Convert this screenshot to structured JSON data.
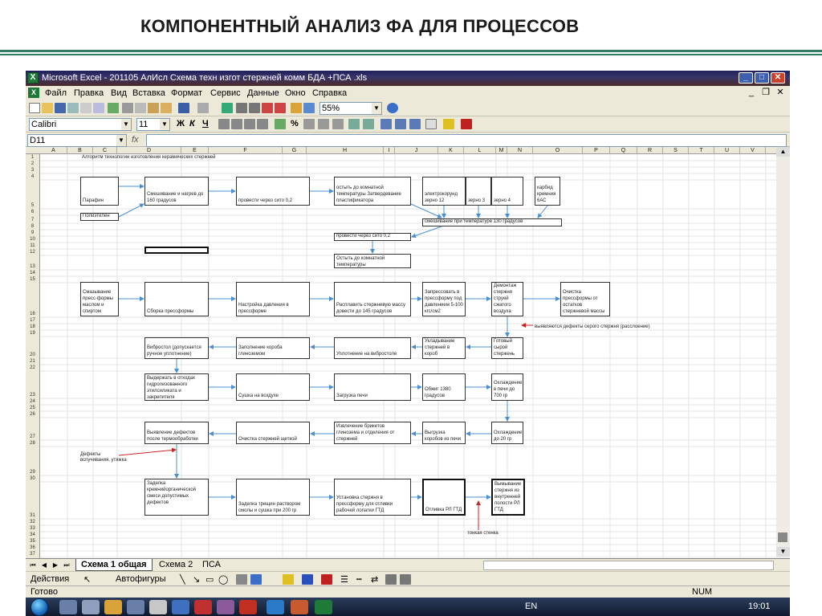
{
  "slide": {
    "title": "КОМПОНЕНТНЫЙ АНАЛИЗ ФА ДЛЯ ПРОЦЕССОВ"
  },
  "window": {
    "app_icon": "excel-icon",
    "caption": "Microsoft Excel - 201105 АлИсл Схема техн изгот стержней комм БДА +ПСА .xls"
  },
  "menu": [
    "Файл",
    "Правка",
    "Вид",
    "Вставка",
    "Формат",
    "Сервис",
    "Данные",
    "Окно",
    "Справка"
  ],
  "toolbar": {
    "zoom": "55%",
    "font": "Calibri",
    "size": "11"
  },
  "formula_bar": {
    "name_box": "D11",
    "fx": "fx"
  },
  "columns": [
    "A",
    "B",
    "C",
    "D",
    "E",
    "F",
    "G",
    "H",
    "I",
    "J",
    "K",
    "L",
    "M",
    "N",
    "O",
    "P",
    "Q",
    "R",
    "S",
    "T",
    "U",
    "V"
  ],
  "rows": [
    "1",
    "2",
    "3",
    "4",
    "5",
    "6",
    "7",
    "8",
    "9",
    "10",
    "11",
    "12",
    "13",
    "14",
    "15",
    "16",
    "17",
    "18",
    "19",
    "20",
    "21",
    "22",
    "23",
    "24",
    "25",
    "26",
    "27",
    "28",
    "29",
    "30",
    "31",
    "32",
    "33",
    "34",
    "35",
    "36",
    "37"
  ],
  "diagram": {
    "heading": "Алгоритм технологии изготовления керамических стержней",
    "boxes": {
      "parafin": "Парафин",
      "polietilen": "Полиэтилен",
      "mixing": "Смешивание и нагрев до 160 градусов",
      "sito1": "провести через сито 0,2",
      "cool_plast": "остыть до комнатной температуры Затвердевание пластификатора",
      "electrocorund": "электрокорунд зерно 12",
      "grain3": "зерно 3",
      "grain4": "зерно 4",
      "carbide": "карбид кремния 6АС",
      "mix130": "смешивание при температуре 130 градусов",
      "sito2": "провести через сито 0,2",
      "cool_room": "Остыть до комнатной температуры",
      "greasing": "Смазывание пресс-формы маслом и спиртом",
      "assembly": "Сборка прессформы",
      "pressure": "Настройка давления в прессформе",
      "melt": "Расплавить стержневую массу довести до 145 градусов",
      "press": "Запрессовать в прессформу под давлением 5-100 кгс/см2",
      "dismount": "Демонтаж стержня струей сжатого воздуха",
      "clean_mold": "Очистка прессформы от остатков стержневой массы",
      "defects_gray": "выявляются дефекты серого стержня (расслоение)",
      "vibro": "Вибростол (допускается ручное уплотнение)",
      "fill_box": "Заполнение короба глиноземом",
      "vib_compact": "Уплотнение на вибростоле",
      "lay": "Укладывание стержней в короб",
      "ready_gray": "Готовый сырой стержень",
      "hold": "Выдержать в отходах гидролизованного этилсиликата и закрепителя",
      "dry": "Сушка на воздухе",
      "load": "Загрузка печи",
      "fire": "Обжиг 1380 градусов",
      "cool700": "Охлаждение в печи до 700 гр",
      "detect": "Выявление дефектов после термообработки",
      "clean_brush": "Очистка стержней щеткой",
      "extract": "Извлечение брикетов глинозема и отделения от стержней",
      "unload": "Выгрузка коробов из печи",
      "cool20": "Охлаждение до 20 гр",
      "bulging": "Дефекты вспучивания, утяжка",
      "repair_mix": "Заделка кремнийорганической смеси допустимых дефектов",
      "crack_seal": "Заделка трещин раствором смолы и сушка при 200 гр",
      "install": "Установка стержня в прессформу для отливки рабочей лопатки ГТД",
      "cast": "Отливка РЛ ГТД",
      "leach": "Вымывание стержня из внутренней полости РЛ ГТД",
      "thin_wall": "тонкая стенка"
    }
  },
  "sheet_tabs": [
    "Схема 1 общая",
    "Схема 2",
    "ПСА"
  ],
  "draw_toolbar": {
    "actions": "Действия",
    "autoshapes": "Автофигуры"
  },
  "status": {
    "left": "Готово",
    "num": "NUM"
  },
  "taskbar": {
    "lang": "EN",
    "clock": "19:01"
  },
  "colors": {
    "accent_rule": "#2e7d60",
    "arrow": "#4a90d0",
    "defect_arrow": "#c62828"
  }
}
